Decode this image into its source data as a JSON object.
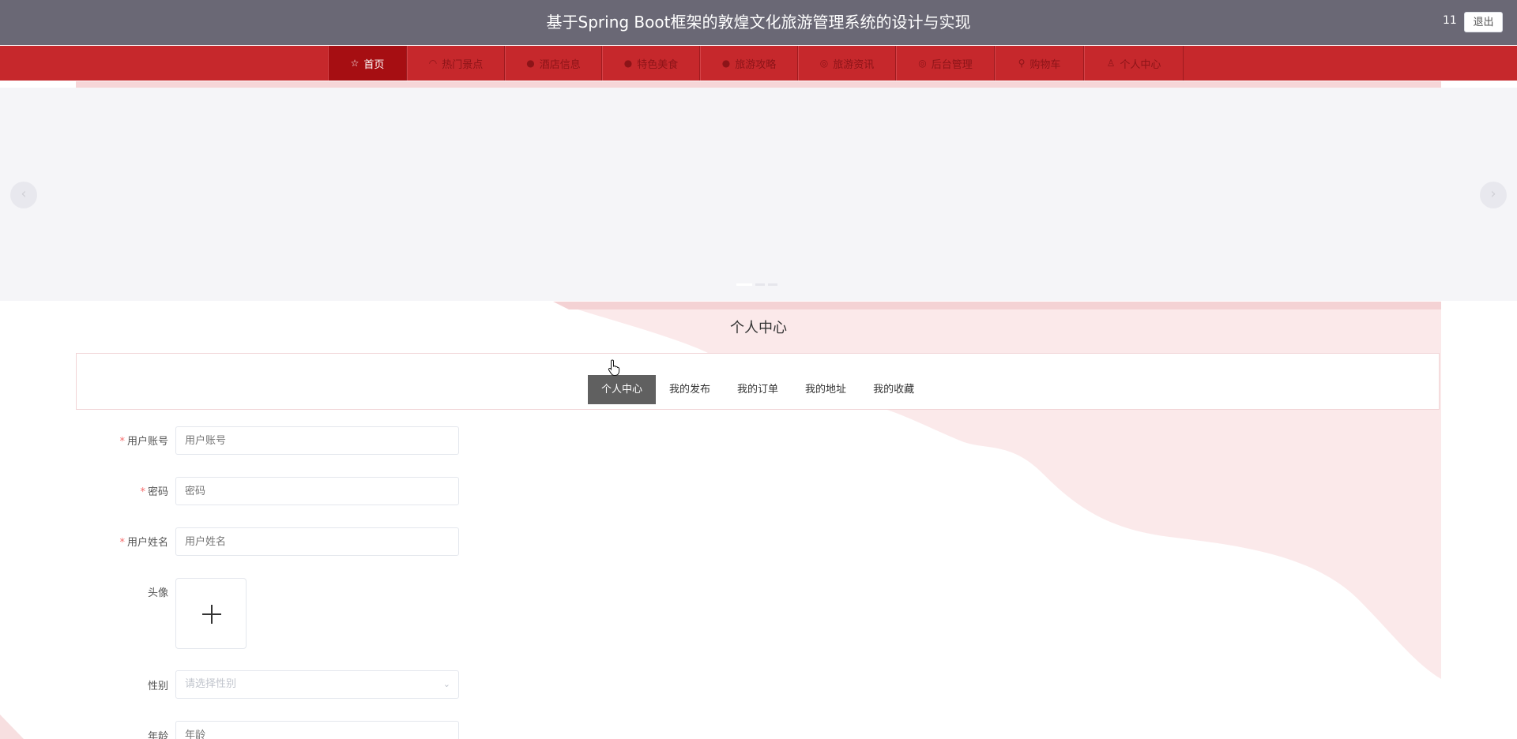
{
  "header": {
    "title": "基于Spring Boot框架的敦煌文化旅游管理系统的设计与实现",
    "user": "11",
    "logout_label": "退出"
  },
  "nav": {
    "items": [
      {
        "icon": "star-icon",
        "glyph": "☆",
        "label": "首页",
        "active": true
      },
      {
        "icon": "headset-icon",
        "glyph": "◠",
        "label": "热门景点",
        "active": false
      },
      {
        "icon": "info-icon",
        "glyph": "●",
        "label": "酒店信息",
        "active": false
      },
      {
        "icon": "question-icon",
        "glyph": "●",
        "label": "特色美食",
        "active": false
      },
      {
        "icon": "info-icon",
        "glyph": "●",
        "label": "旅游攻略",
        "active": false
      },
      {
        "icon": "eye-icon",
        "glyph": "◎",
        "label": "旅游资讯",
        "active": false
      },
      {
        "icon": "user-settings-icon",
        "glyph": "◎",
        "label": "后台管理",
        "active": false
      },
      {
        "icon": "cart-icon",
        "glyph": "⚲",
        "label": "购物车",
        "active": false
      },
      {
        "icon": "user-icon",
        "glyph": "♙",
        "label": "个人中心",
        "active": false
      }
    ]
  },
  "carousel": {
    "prev_glyph": "‹",
    "next_glyph": "›",
    "dot_count": 3,
    "active_dot": 0
  },
  "section": {
    "title": "个人中心"
  },
  "tabs": {
    "items": [
      {
        "label": "个人中心",
        "active": true
      },
      {
        "label": "我的发布",
        "active": false
      },
      {
        "label": "我的订单",
        "active": false
      },
      {
        "label": "我的地址",
        "active": false
      },
      {
        "label": "我的收藏",
        "active": false
      }
    ]
  },
  "form": {
    "username": {
      "label": "用户账号",
      "required": true,
      "placeholder": "用户账号",
      "value": ""
    },
    "password": {
      "label": "密码",
      "required": true,
      "placeholder": "密码",
      "value": ""
    },
    "realname": {
      "label": "用户姓名",
      "required": true,
      "placeholder": "用户姓名",
      "value": ""
    },
    "avatar": {
      "label": "头像"
    },
    "gender": {
      "label": "性别",
      "placeholder": "请选择性别",
      "value": ""
    },
    "age": {
      "label": "年龄",
      "placeholder": "年龄",
      "value": ""
    }
  },
  "colors": {
    "header_bg": "#6a6875",
    "nav_bg": "#c6282c",
    "nav_active": "#a60e12",
    "tab_active": "#606060",
    "required": "#f56c6c",
    "decor_pink": "#fbe9ea"
  }
}
